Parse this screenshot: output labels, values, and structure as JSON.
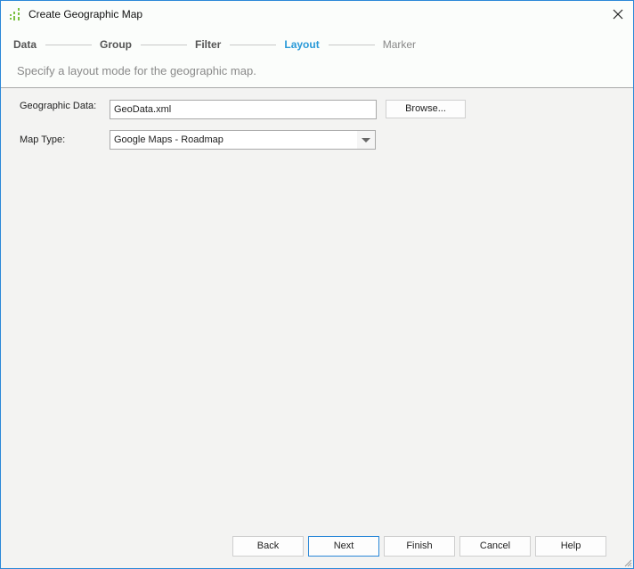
{
  "window": {
    "title": "Create Geographic Map",
    "icon": "bar-chart-icon",
    "close_icon": "close-icon"
  },
  "steps": [
    {
      "label": "Data",
      "state": "done"
    },
    {
      "label": "Group",
      "state": "done"
    },
    {
      "label": "Filter",
      "state": "done"
    },
    {
      "label": "Layout",
      "state": "active"
    },
    {
      "label": "Marker",
      "state": "future"
    }
  ],
  "header": {
    "subtitle": "Specify a layout mode for the geographic map."
  },
  "form": {
    "geo_label": "Geographic Data:",
    "geo_value": "GeoData.xml",
    "browse_label": "Browse...",
    "map_type_label": "Map Type:",
    "map_type_value": "Google Maps - Roadmap"
  },
  "footer": {
    "back": "Back",
    "next": "Next",
    "finish": "Finish",
    "cancel": "Cancel",
    "help": "Help"
  },
  "colors": {
    "accent": "#2a9ad8",
    "icon_green": "#6bbf3a"
  }
}
